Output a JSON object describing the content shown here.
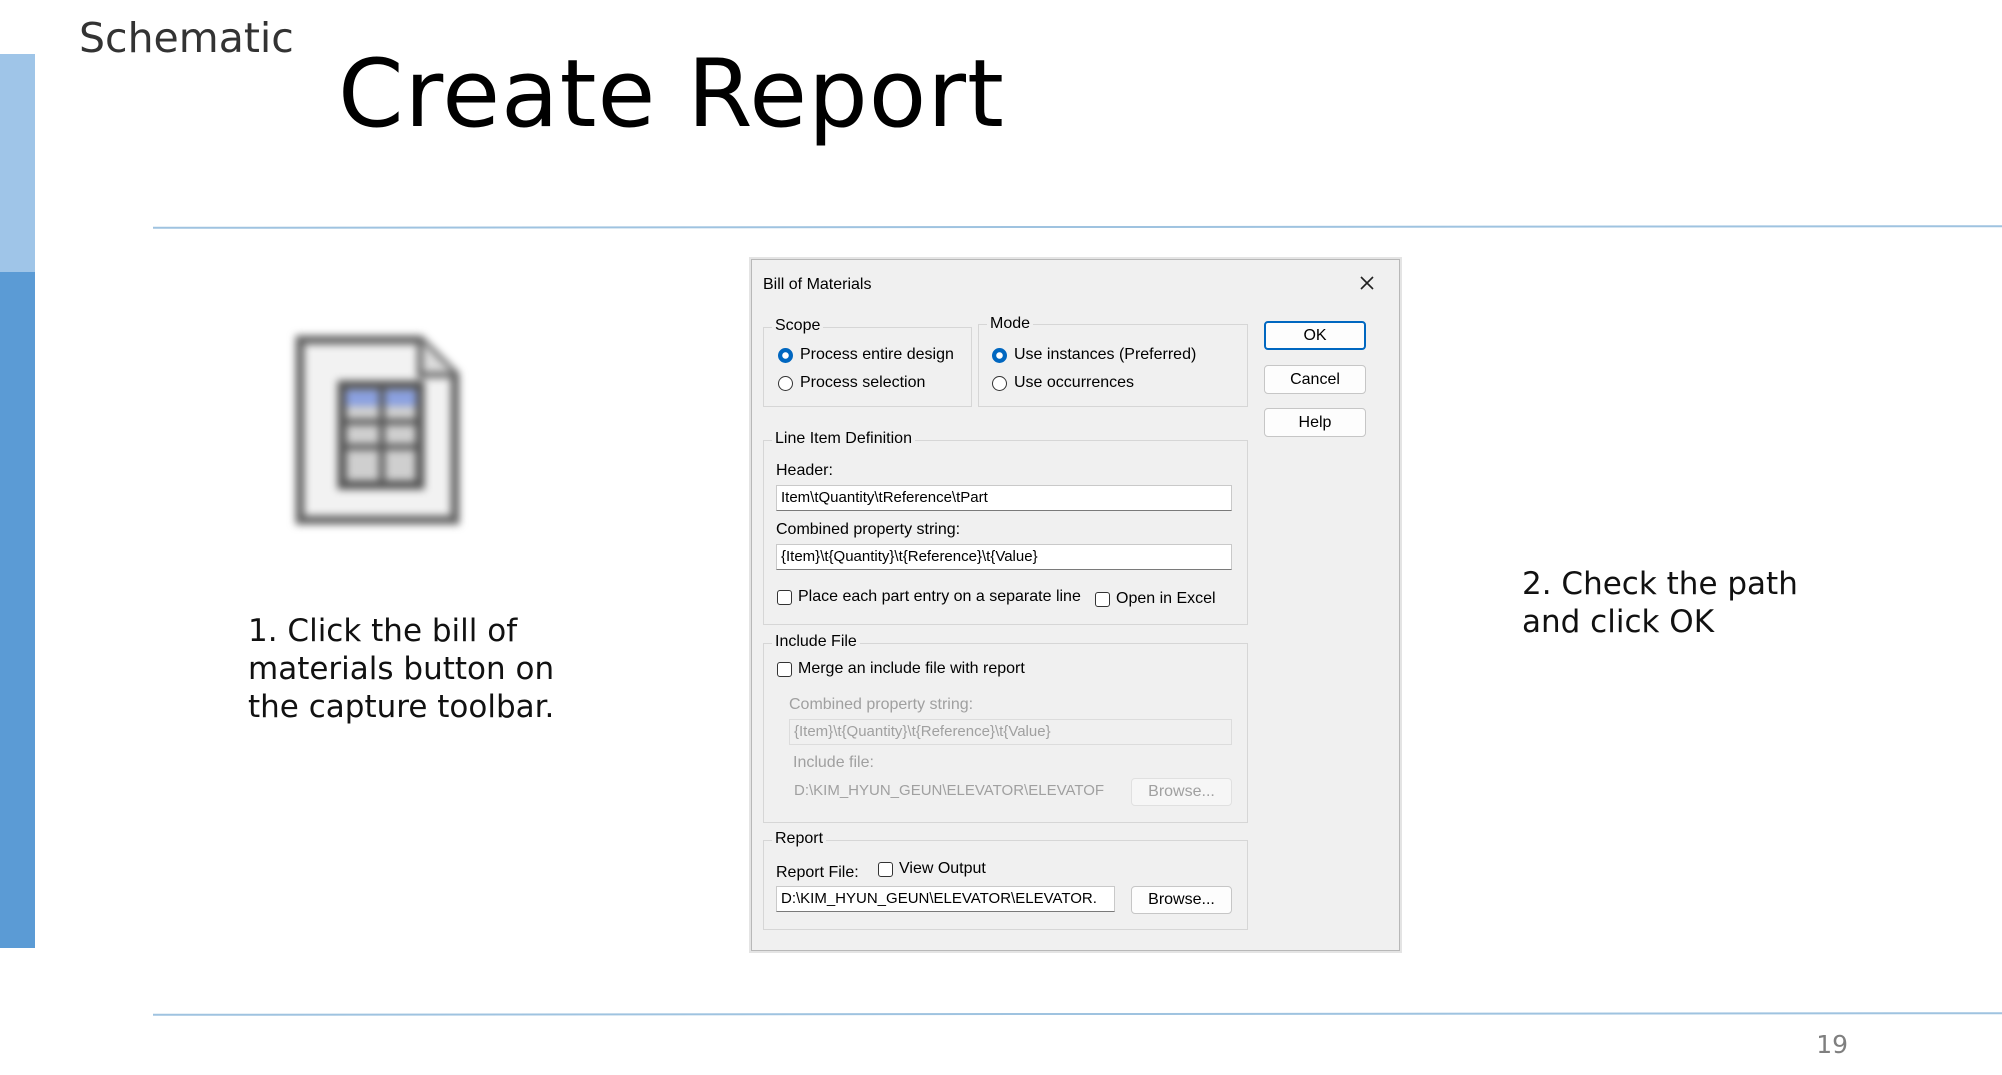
{
  "slide": {
    "section": "Schematic",
    "title": "Create Report",
    "page_number": "19",
    "step1": [
      "1. Click the bill of",
      "materials button on",
      "the capture toolbar."
    ],
    "step2": [
      "2. Check the path",
      "and click OK"
    ],
    "accent_light": "#9fc5e8",
    "accent_dark": "#5b9bd5"
  },
  "toolbar_icon": {
    "name": "bill-of-materials-icon"
  },
  "dialog": {
    "title": "Bill of Materials",
    "close_icon": "close-icon",
    "scope": {
      "legend": "Scope",
      "options": [
        "Process entire design",
        "Process selection"
      ],
      "selected": "Process entire design"
    },
    "mode": {
      "legend": "Mode",
      "options": [
        "Use instances (Preferred)",
        "Use occurrences"
      ],
      "selected": "Use instances (Preferred)"
    },
    "buttons": {
      "ok": "OK",
      "cancel": "Cancel",
      "help": "Help"
    },
    "line_item": {
      "legend": "Line Item Definition",
      "header_label": "Header:",
      "header_value": "Item\\tQuantity\\tReference\\tPart",
      "combined_label": "Combined property string:",
      "combined_value": "{Item}\\t{Quantity}\\t{Reference}\\t{Value}",
      "separate_line_label": "Place each part entry on a separate line",
      "separate_line_checked": false,
      "open_excel_label": "Open in Excel",
      "open_excel_checked": false
    },
    "include_file": {
      "legend": "Include File",
      "merge_label": "Merge an include file with report",
      "merge_checked": false,
      "combined_label": "Combined property string:",
      "combined_value": "{Item}\\t{Quantity}\\t{Reference}\\t{Value}",
      "file_label": "Include file:",
      "file_value": "D:\\KIM_HYUN_GEUN\\ELEVATOR\\ELEVATOF",
      "browse_label": "Browse..."
    },
    "report": {
      "legend": "Report",
      "file_label": "Report File:",
      "view_output_label": "View Output",
      "view_output_checked": false,
      "file_value": "D:\\KIM_HYUN_GEUN\\ELEVATOR\\ELEVATOR.",
      "browse_label": "Browse..."
    }
  }
}
